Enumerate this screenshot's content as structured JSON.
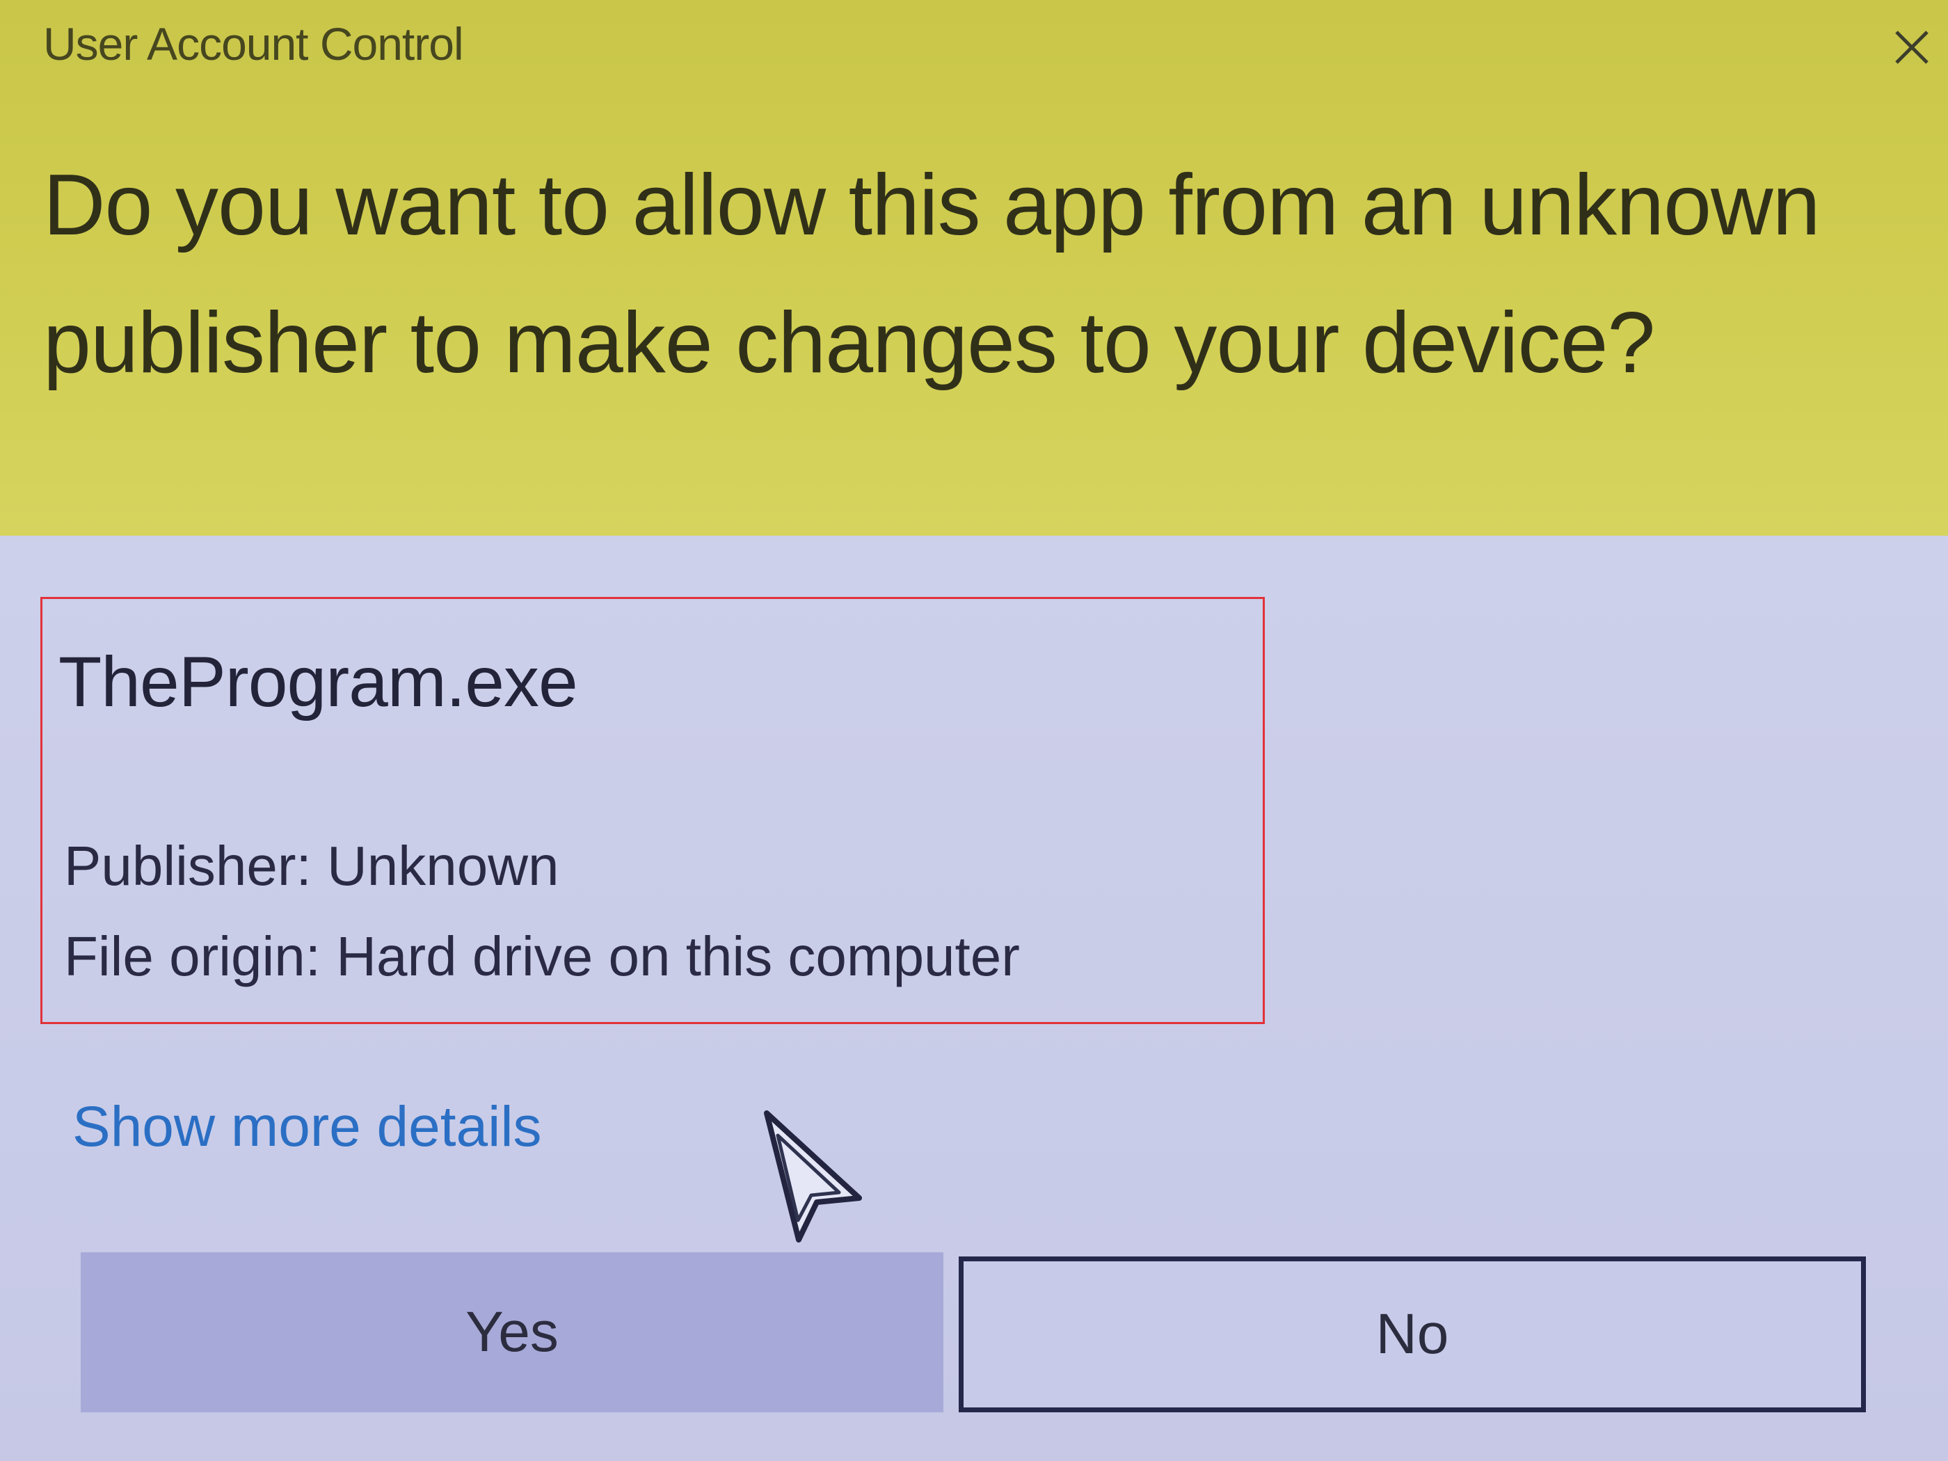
{
  "dialog": {
    "title": "User Account Control",
    "question": "Do you want to allow this app from an unknown publisher to make changes to your device?",
    "program_name": "TheProgram.exe",
    "publisher": "Publisher: Unknown",
    "file_origin": "File origin: Hard drive on this computer",
    "more_details_link": "Show more details",
    "yes_label": "Yes",
    "no_label": "No",
    "close_icon": "close-icon",
    "cursor_icon": "mouse-pointer-icon"
  },
  "colors": {
    "header_background": "#cfcc50",
    "body_background": "#c9cce8",
    "highlight_border": "#e1323a",
    "link": "#2b6fc4",
    "yes_button": "#a7aad8",
    "no_button_border": "#25274a"
  }
}
